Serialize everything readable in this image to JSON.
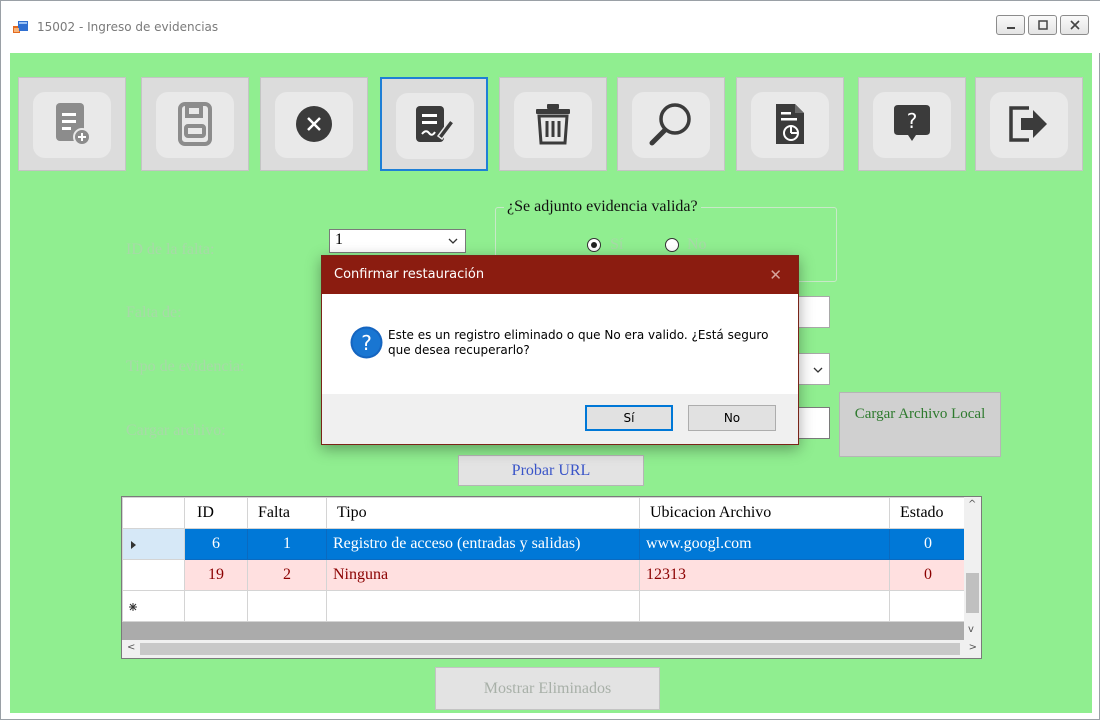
{
  "window": {
    "title": "15002 - Ingreso de evidencias"
  },
  "toolbar": {
    "buttons": [
      {
        "icon": "new-document-icon",
        "active": false
      },
      {
        "icon": "save-icon",
        "active": false
      },
      {
        "icon": "cancel-icon",
        "active": false
      },
      {
        "icon": "edit-icon",
        "active": true
      },
      {
        "icon": "trash-icon",
        "active": false
      },
      {
        "icon": "search-icon",
        "active": false
      },
      {
        "icon": "report-icon",
        "active": false
      },
      {
        "icon": "help-icon",
        "active": false
      },
      {
        "icon": "exit-icon",
        "active": false
      }
    ]
  },
  "form": {
    "id_label": "ID de la falta:",
    "id_value": "1",
    "falta_label": "Falta de:",
    "tipo_label": "Tipo de evidencia:",
    "cargar_label": "Cargar archivo:",
    "group_title": "¿Se adjunto evidencia valida?",
    "radio_si": "Sí",
    "radio_no": "No",
    "radio_selected": "Sí",
    "load_button": "Cargar Archivo Local",
    "test_url_button": "Probar URL",
    "show_deleted_button": "Mostrar Eliminados"
  },
  "grid": {
    "columns": [
      "ID",
      "Falta",
      "Tipo",
      "Ubicacion Archivo",
      "Estado"
    ],
    "rows": [
      {
        "id": "6",
        "falta": "1",
        "tipo": "Registro de acceso (entradas y salidas)",
        "ubicacion": "www.googl.com",
        "estado": "0"
      },
      {
        "id": "19",
        "falta": "2",
        "tipo": "Ninguna",
        "ubicacion": "12313",
        "estado": "0"
      }
    ]
  },
  "dialog": {
    "title": "Confirmar restauración",
    "message": "Este es un registro eliminado o que No era valido. ¿Está seguro que desea recuperarlo?",
    "yes_button": "Sí",
    "no_button": "No"
  },
  "colors": {
    "client_background": "#90ee90",
    "dialog_title_bar": "#8b1c10",
    "selection": "#0078d7",
    "pink_row": "#ffe0e0"
  }
}
